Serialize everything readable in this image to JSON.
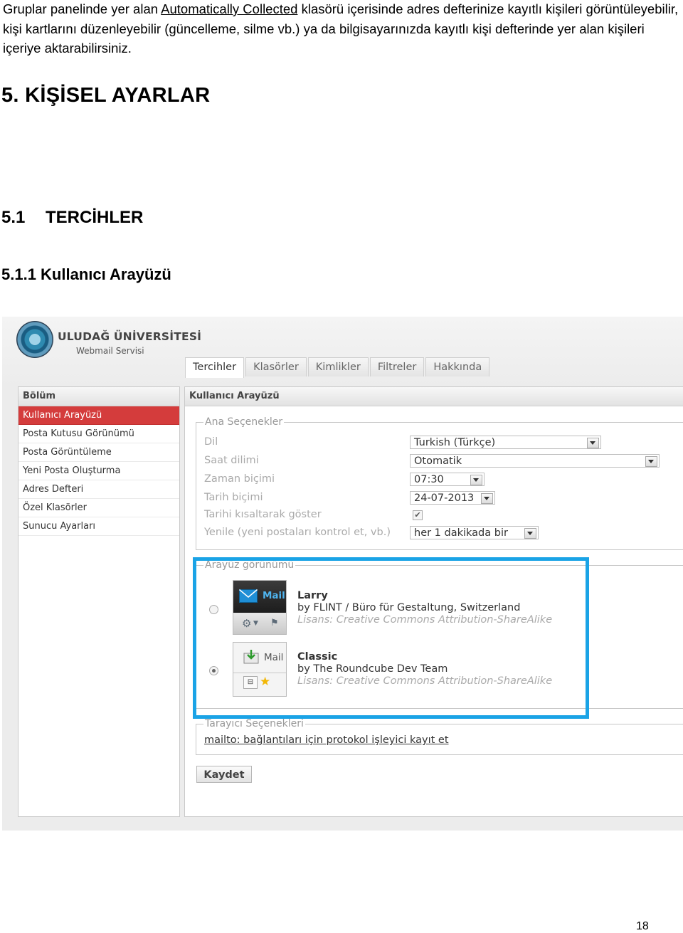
{
  "intro": {
    "before": "Gruplar panelinde yer alan ",
    "link": "Automatically Collected",
    "after": " klasörü içerisinde adres defterinize kayıtlı kişileri görüntüleyebilir, kişi kartlarını düzenleyebilir (güncelleme, silme vb.) ya da bilgisayarınızda kayıtlı kişi defterinde yer alan kişileri içeriye aktarabilirsiniz."
  },
  "section_title": "5. KİŞİSEL AYARLAR",
  "subsection": {
    "number": "5.1",
    "title": "TERCİHLER"
  },
  "subsubsection": "5.1.1 Kullanıcı Arayüzü",
  "page_number": "18",
  "screenshot": {
    "header": {
      "university": "ULUDAĞ ÜNİVERSİTESİ",
      "service": "Webmail Servisi"
    },
    "tabs": [
      "Tercihler",
      "Klasörler",
      "Kimlikler",
      "Filtreler",
      "Hakkında"
    ],
    "sidebar": {
      "heading": "Bölüm",
      "items": [
        "Kullanıcı Arayüzü",
        "Posta Kutusu Görünümü",
        "Posta Görüntüleme",
        "Yeni Posta Oluşturma",
        "Adres Defteri",
        "Özel Klasörler",
        "Sunucu Ayarları"
      ]
    },
    "main": {
      "heading": "Kullanıcı Arayüzü",
      "main_options": {
        "legend": "Ana Seçenekler",
        "language_label": "Dil",
        "language_value": "Turkish (Türkçe)",
        "timezone_label": "Saat dilimi",
        "timezone_value": "Otomatik",
        "time_format_label": "Zaman biçimi",
        "time_format_value": "07:30",
        "date_format_label": "Tarih biçimi",
        "date_format_value": "24-07-2013",
        "pretty_date_label": "Tarihi kısaltarak göster",
        "pretty_date_checked": true,
        "refresh_label": "Yenile (yeni postaları kontrol et, vb.)",
        "refresh_value": "her 1 dakikada bir"
      },
      "skin": {
        "legend": "Arayüz görünümü",
        "options": [
          {
            "name": "Larry",
            "by": "by FLINT / Büro für Gestaltung, Switzerland",
            "license": "Lisans: Creative Commons Attribution-ShareAlike",
            "thumb_label": "Mail",
            "selected": false
          },
          {
            "name": "Classic",
            "by": "by The Roundcube Dev Team",
            "license": "Lisans: Creative Commons Attribution-ShareAlike",
            "thumb_label": "Mail",
            "selected": true
          }
        ]
      },
      "browser_options": {
        "legend": "Tarayıcı Seçenekleri",
        "protocol_link": "mailto: bağlantıları için protokol işleyici kayıt et"
      },
      "save_label": "Kaydet"
    },
    "colors": {
      "selected_nav": "#d43c3c",
      "highlight_frame": "#1aa3e6"
    }
  }
}
